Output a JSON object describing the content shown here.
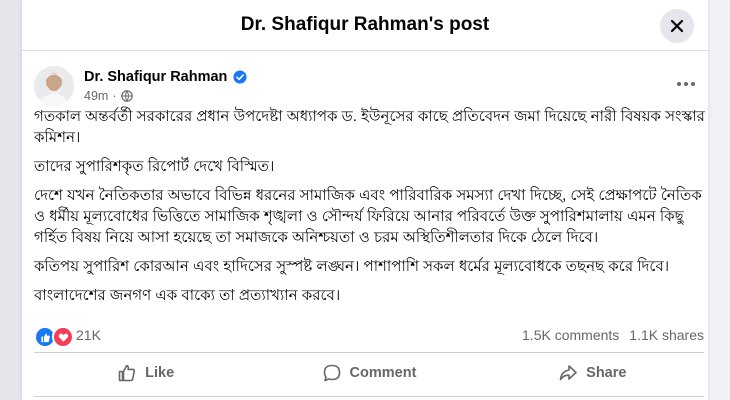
{
  "dialog": {
    "title": "Dr. Shafiqur Rahman's post"
  },
  "post": {
    "author": "Dr. Shafiqur Rahman",
    "time": "49m",
    "paragraphs": [
      "গতকাল অন্তর্বর্তী সরকারের প্রধান উপদেষ্টা অধ্যাপক ড. ইউনূসের কাছে প্রতিবেদন জমা দিয়েছে নারী বিষয়ক সংস্কার কমিশন।",
      "তাদের সুপারিশকৃত রিপোর্ট দেখে বিস্মিত।",
      "দেশে যখন নৈতিকতার অভাবে বিভিন্ন ধরনের সামাজিক এবং পারিবারিক সমস্যা দেখা দিচ্ছে, সেই প্রেক্ষাপটে নৈতিক ও ধর্মীয় মূল্যবোধের ভিত্তিতে সামাজিক শৃঙ্খলা ও সৌন্দর্য ফিরিয়ে আনার পরিবর্তে উক্ত সুপারিশমালায় এমন কিছু গর্হিত বিষয় নিয়ে আসা হয়েছে তা সমাজকে অনিশ্চয়তা ও চরম অস্থিতিশীলতার দিকে ঠেলে দিবে।",
      "কতিপয় সুপারিশ কোরআন এবং হাদিসের সুস্পষ্ট লঙ্ঘন। পাশাপাশি সকল ধর্মের মূল্যবোধকে তছনছ করে দিবে।",
      "বাংলাদেশের জনগণ এক বাক্যে তা প্রত্যাখ্যান করবে।"
    ],
    "reactions_count": "21K",
    "comments_count": "1.5K comments",
    "shares_count": "1.1K shares"
  },
  "actions": {
    "like": "Like",
    "comment": "Comment",
    "share": "Share"
  },
  "icons": {
    "close": "close-icon",
    "verified": "verified-badge-icon",
    "privacy": "public-globe-icon",
    "more": "more-options-icon",
    "like_reaction": "like-reaction-icon",
    "love_reaction": "love-reaction-icon",
    "like_action": "thumbs-up-icon",
    "comment_action": "comment-bubble-icon",
    "share_action": "share-arrow-icon"
  },
  "colors": {
    "accent": "#1877f2",
    "love": "#f33e58",
    "muted_text": "#65676b"
  }
}
